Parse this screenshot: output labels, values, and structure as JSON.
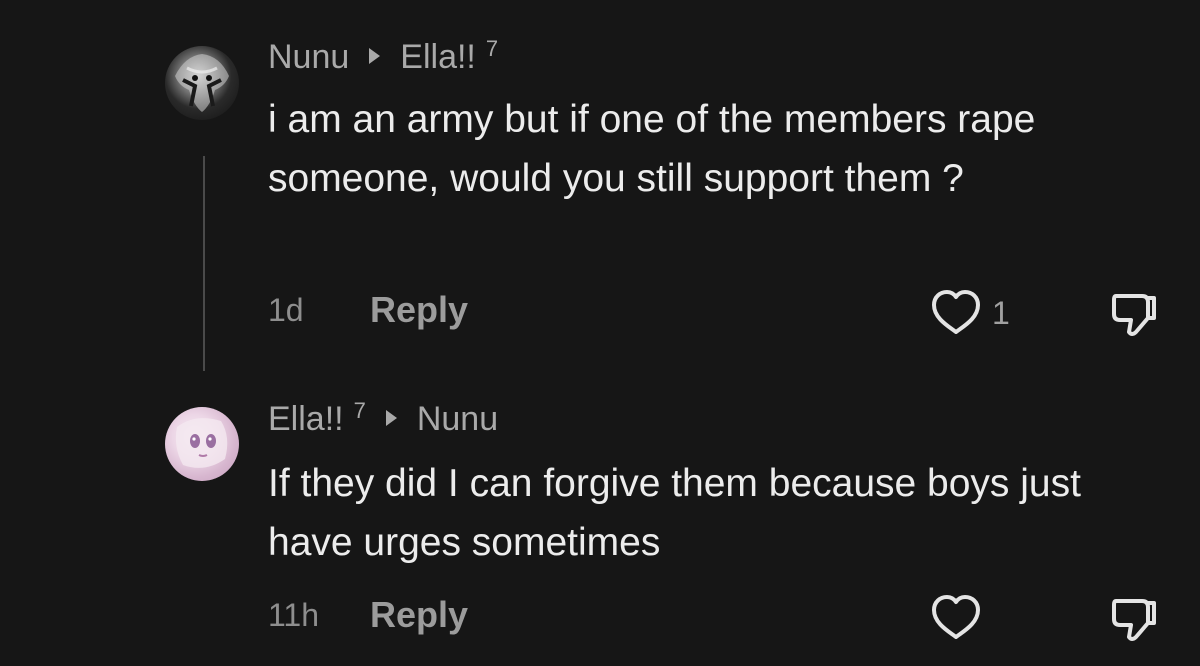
{
  "comments": [
    {
      "author": "Nunu",
      "reply_to": "Ella!!",
      "reply_to_badge": "7",
      "text": "i am an army but if one of the members rape someone, would you still support them ?",
      "time": "1d",
      "reply_label": "Reply",
      "like_count": "1",
      "avatar_icon": "avatar-icon"
    },
    {
      "author": "Ella!!",
      "author_badge": "7",
      "reply_to": "Nunu",
      "text": "If they did I can forgive them because boys just have urges sometimes",
      "time": "11h",
      "reply_label": "Reply",
      "like_count": "",
      "avatar_icon": "avatar-icon"
    }
  ],
  "icons": {
    "like": "heart-icon",
    "dislike": "thumbs-down-icon",
    "reply_arrow": "caret-right-icon"
  },
  "colors": {
    "background": "#161616",
    "text_primary": "#ececec",
    "text_secondary": "#a9a9a9"
  }
}
